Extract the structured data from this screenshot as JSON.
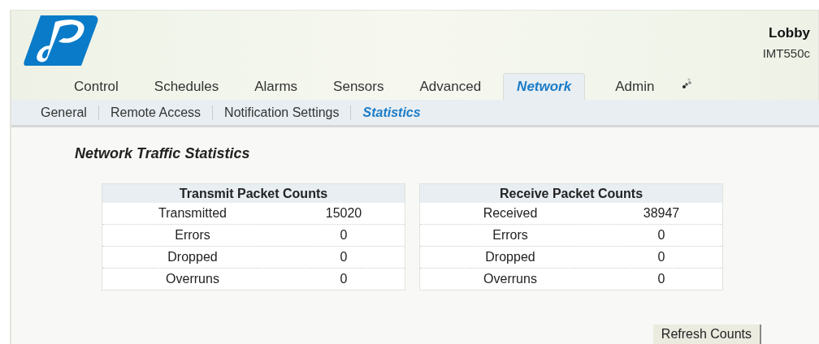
{
  "header": {
    "device_name": "Lobby",
    "device_model": "IMT550c"
  },
  "tabs": [
    {
      "label": "Control",
      "selected": false
    },
    {
      "label": "Schedules",
      "selected": false
    },
    {
      "label": "Alarms",
      "selected": false
    },
    {
      "label": "Sensors",
      "selected": false
    },
    {
      "label": "Advanced",
      "selected": false
    },
    {
      "label": "Network",
      "selected": true
    },
    {
      "label": "Admin",
      "selected": false
    }
  ],
  "subtabs": [
    {
      "label": "General",
      "selected": false
    },
    {
      "label": "Remote Access",
      "selected": false
    },
    {
      "label": "Notification Settings",
      "selected": false
    },
    {
      "label": "Statistics",
      "selected": true
    }
  ],
  "page_title": "Network Traffic Statistics",
  "tables": [
    {
      "title": "Transmit Packet Counts",
      "rows": [
        [
          "Transmitted",
          "15020"
        ],
        [
          "Errors",
          "0"
        ],
        [
          "Dropped",
          "0"
        ],
        [
          "Overruns",
          "0"
        ]
      ]
    },
    {
      "title": "Receive Packet Counts",
      "rows": [
        [
          "Received",
          "38947"
        ],
        [
          "Errors",
          "0"
        ],
        [
          "Dropped",
          "0"
        ],
        [
          "Overruns",
          "0"
        ]
      ]
    }
  ],
  "refresh_button": "Refresh Counts"
}
